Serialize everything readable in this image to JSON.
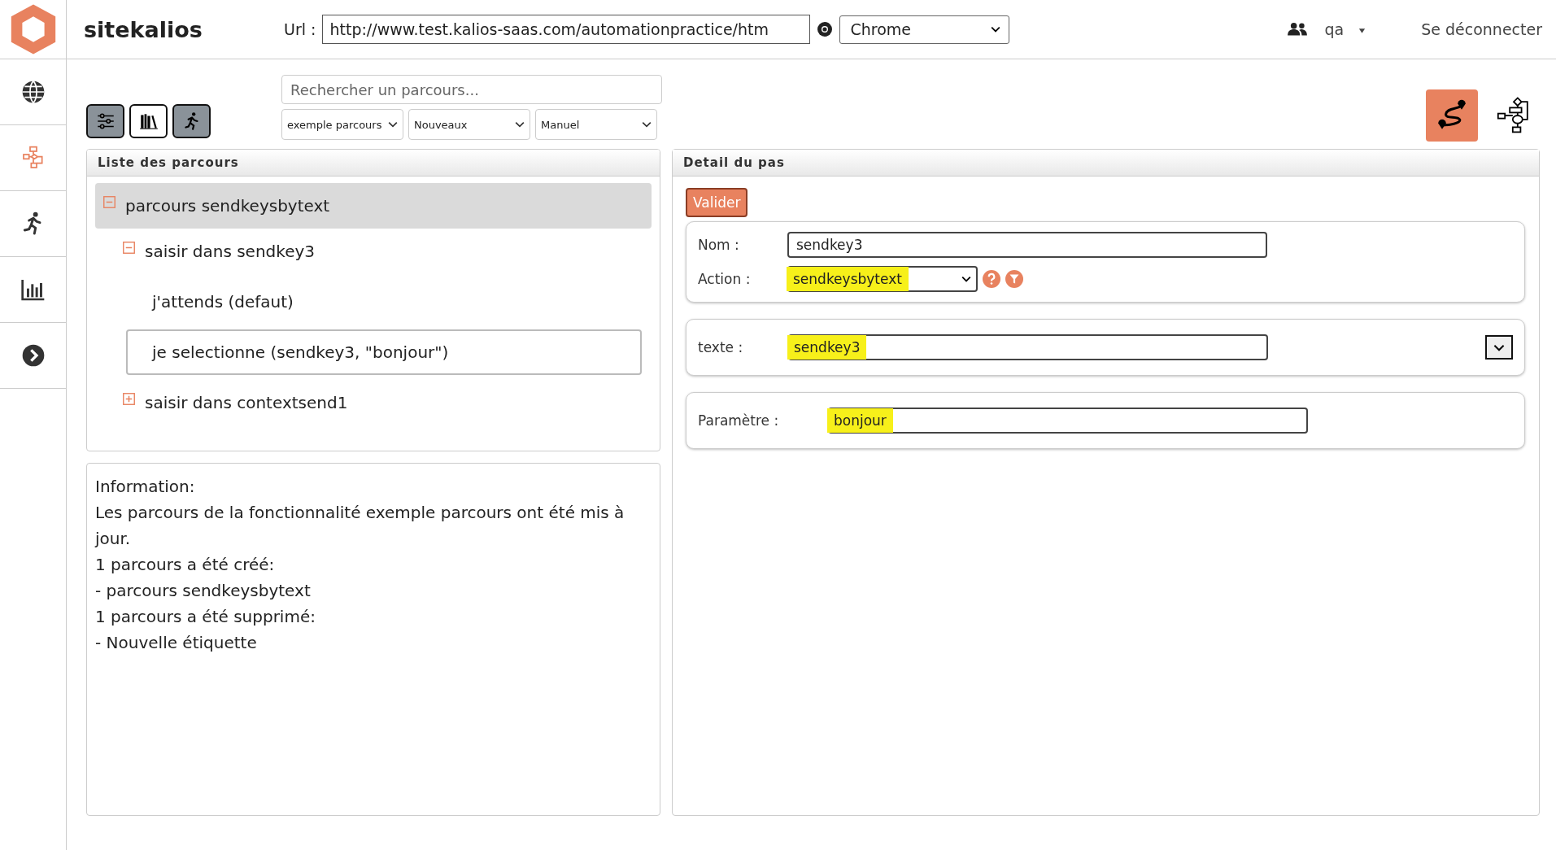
{
  "header": {
    "app_name": "sitekalios",
    "url_label": "Url :",
    "url": "http://www.test.kalios-saas.com/automationpractice/htm",
    "browser": "Chrome",
    "user": "qa",
    "logout": "Se déconnecter"
  },
  "sidebar": {
    "items": [
      {
        "kind": "globe",
        "selected": false
      },
      {
        "kind": "flowchart",
        "selected": true
      },
      {
        "kind": "runner",
        "selected": false
      },
      {
        "kind": "chart",
        "selected": false
      },
      {
        "kind": "next",
        "selected": false
      }
    ]
  },
  "toolbar": {
    "buttons": [
      {
        "kind": "sliders",
        "on": true
      },
      {
        "kind": "books",
        "on": false
      },
      {
        "kind": "runner",
        "on": true
      }
    ],
    "search": {
      "placeholder": "Rechercher un parcours..."
    },
    "filters": [
      "exemple parcours",
      "Nouveaux",
      "Manuel"
    ],
    "views": [
      {
        "kind": "route",
        "selected": true
      },
      {
        "kind": "flowchart",
        "selected": false
      }
    ]
  },
  "tree_panel": {
    "title": "Liste des parcours",
    "items": [
      {
        "label": "parcours sendkeysbytext",
        "expanded": true,
        "selected": true,
        "current": false,
        "children": [
          {
            "label": "saisir dans sendkey3",
            "expanded": true,
            "selected": false,
            "current": false,
            "children": [
              {
                "label": "j'attends (defaut)",
                "selected": false,
                "current": false
              },
              {
                "label": "je selectionne (sendkey3, \"bonjour\")",
                "selected": false,
                "current": true
              }
            ]
          },
          {
            "label": "saisir dans contextsend1",
            "expanded": false,
            "selected": false,
            "current": false
          }
        ]
      }
    ]
  },
  "info_panel": {
    "lines": [
      "Information:",
      "Les parcours de la fonctionnalité exemple parcours ont été mis à jour.",
      "1 parcours a été créé:",
      "- parcours sendkeysbytext",
      "1 parcours a été supprimé:",
      "- Nouvelle étiquette"
    ]
  },
  "detail_panel": {
    "title": "Detail du pas",
    "submit": "Valider",
    "name": {
      "label": "Nom :",
      "value": "sendkey3",
      "highlighted": false
    },
    "action": {
      "label": "Action :",
      "value": "sendkeysbytext",
      "highlighted": true
    },
    "text": {
      "label": "texte :",
      "value": "sendkey3",
      "highlighted": true
    },
    "parameter": {
      "label": "Paramètre :",
      "value": "bonjour",
      "highlighted": true
    }
  }
}
